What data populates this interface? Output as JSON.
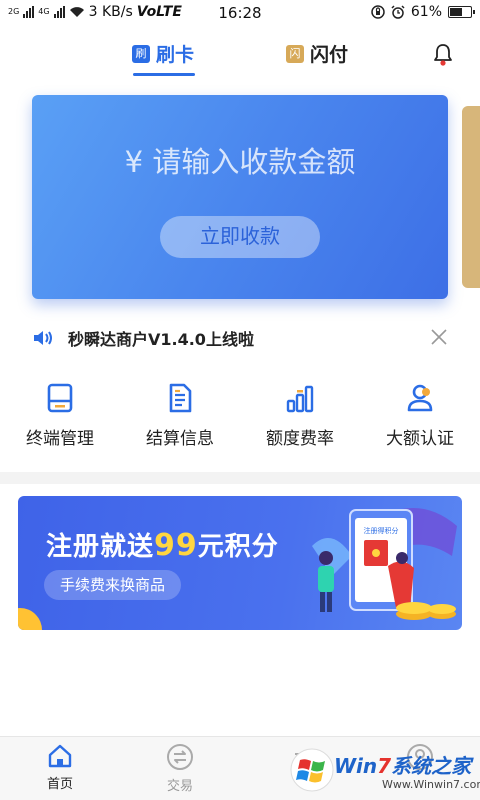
{
  "status_bar": {
    "network_labels": [
      "2G",
      "4G"
    ],
    "speed": "3 KB/s",
    "volte": "VoLTE",
    "time": "16:28",
    "battery": "61%",
    "battery_level": 0.61
  },
  "top_tabs": {
    "swipe": {
      "badge": "刷",
      "label": "刷卡",
      "active": true
    },
    "flash": {
      "badge": "闪",
      "label": "闪付",
      "active": false
    }
  },
  "amount_card": {
    "prompt": "¥ 请输入收款金额",
    "button": "立即收款"
  },
  "notice": {
    "text": "秒瞬达商户V1.4.0上线啦"
  },
  "quick_actions": [
    {
      "label": "终端管理",
      "icon": "terminal-icon"
    },
    {
      "label": "结算信息",
      "icon": "document-icon"
    },
    {
      "label": "额度费率",
      "icon": "bar-chart-icon"
    },
    {
      "label": "大额认证",
      "icon": "user-verify-icon"
    }
  ],
  "banner": {
    "title_pre": "注册就送",
    "title_num": "99",
    "title_post": "元积分",
    "subtitle": "手续费来换商品",
    "phone_text": "注册得积分"
  },
  "bottom_nav": {
    "home": "首页",
    "trade": "交易"
  },
  "watermark": {
    "brand_pre": "Win",
    "brand_num": "7",
    "brand_post": "系统之家",
    "url": "Www.Winwin7.com"
  },
  "colors": {
    "accent": "#2b6de5",
    "gold": "#d7a958",
    "banner_highlight": "#ffd640"
  }
}
